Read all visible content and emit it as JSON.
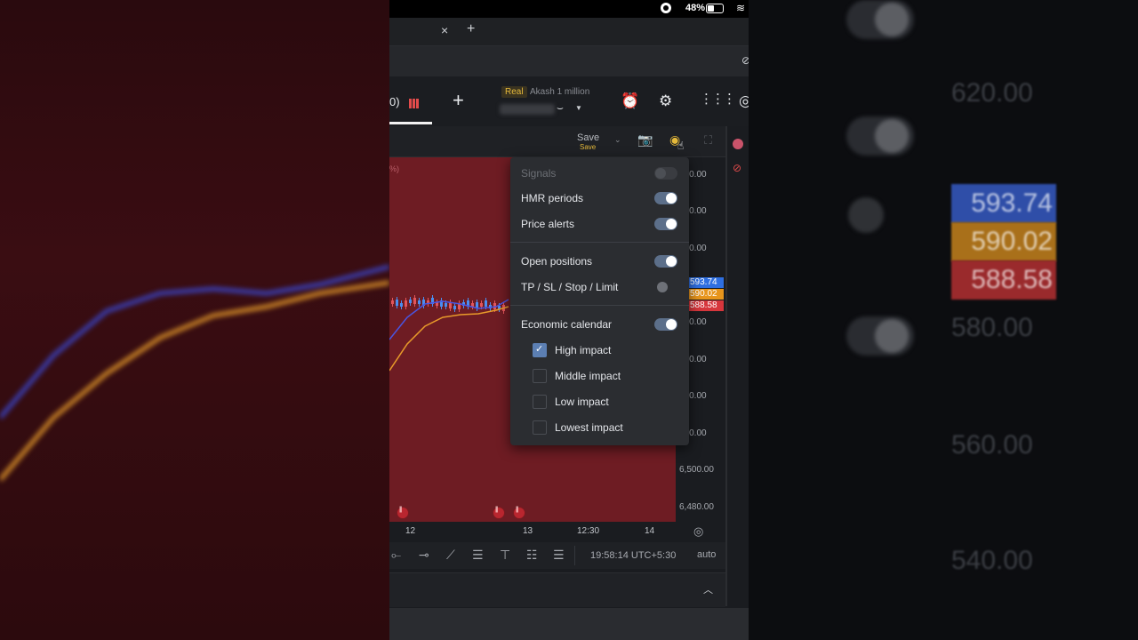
{
  "status_bar": {
    "battery": "48%"
  },
  "tab_bar": {
    "close": "×",
    "new": "+"
  },
  "toolbar": {
    "assets_count": "0)",
    "add": "+",
    "account_type": "Real",
    "account_name": "Akash 1 million"
  },
  "chart_header": {
    "save": "Save",
    "save_sub": "Save"
  },
  "chart": {
    "corner_label": "%)"
  },
  "menu": {
    "signals": "Signals",
    "hmr": "HMR periods",
    "price_alerts": "Price alerts",
    "open_positions": "Open positions",
    "tp_sl": "TP / SL / Stop / Limit",
    "economic_calendar": "Economic calendar",
    "impacts": [
      "High impact",
      "Middle impact",
      "Low impact",
      "Lowest impact"
    ],
    "toggles": {
      "signals": false,
      "hmr": true,
      "price_alerts": true,
      "open_positions": true,
      "tp_sl": false,
      "economic_calendar": true
    },
    "impact_checked": [
      true,
      false,
      false,
      false
    ]
  },
  "price_axis": {
    "labels": [
      "560.00",
      "540.00",
      "520.00",
      "580.00",
      "560.00",
      "540.00",
      "520.00",
      "6,500.00",
      "6,480.00"
    ],
    "tags": [
      "593.74",
      "590.02",
      "588.58"
    ],
    "tag_colors": [
      "#2f6fe0",
      "#e7951c",
      "#d6363c"
    ]
  },
  "time_axis": {
    "labels": [
      "12",
      "13",
      "12:30",
      "14"
    ]
  },
  "bottom": {
    "clock": "19:58:14 UTC+5:30",
    "auto": "auto"
  },
  "background_right": {
    "prices": [
      "620.00",
      "593.74",
      "590.02",
      "588.58",
      "580.00",
      "560.00",
      "540.00"
    ]
  }
}
